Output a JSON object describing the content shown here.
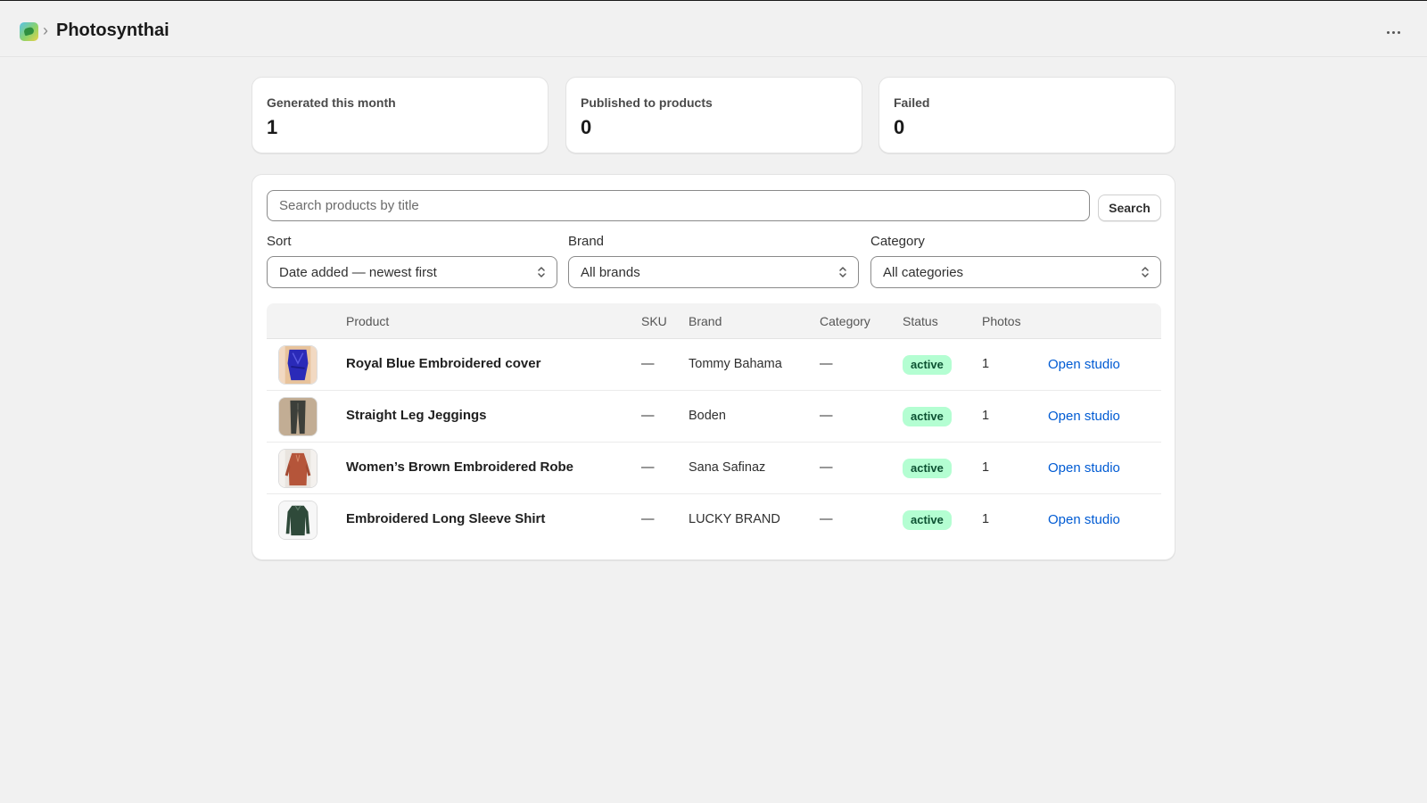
{
  "app": {
    "title": "Photosynthai",
    "breadcrumb_separator": "›",
    "icon": "app-leaf-icon",
    "more_icon": "more-horizontal-icon"
  },
  "stats": [
    {
      "label": "Generated this month",
      "value": "1"
    },
    {
      "label": "Published to products",
      "value": "0"
    },
    {
      "label": "Failed",
      "value": "0"
    }
  ],
  "search": {
    "placeholder": "Search products by title",
    "value": "",
    "button_label": "Search"
  },
  "filters": {
    "sort": {
      "label": "Sort",
      "value": "Date added — newest first"
    },
    "brand": {
      "label": "Brand",
      "value": "All brands"
    },
    "category": {
      "label": "Category",
      "value": "All categories"
    }
  },
  "table": {
    "columns": {
      "product": "Product",
      "sku": "SKU",
      "brand": "Brand",
      "category": "Category",
      "status": "Status",
      "photos": "Photos"
    },
    "rows": [
      {
        "product": "Royal Blue Embroidered cover",
        "sku": "—",
        "brand": "Tommy Bahama",
        "category": "—",
        "status": "active",
        "photos": "1",
        "action": "Open studio",
        "thumb": "royal-blue-garment"
      },
      {
        "product": "Straight Leg Jeggings",
        "sku": "—",
        "brand": "Boden",
        "category": "—",
        "status": "active",
        "photos": "1",
        "action": "Open studio",
        "thumb": "dark-jeggings"
      },
      {
        "product": "Women’s Brown Embroidered Robe",
        "sku": "—",
        "brand": "Sana Safinaz",
        "category": "—",
        "status": "active",
        "photos": "1",
        "action": "Open studio",
        "thumb": "brown-robe"
      },
      {
        "product": "Embroidered Long Sleeve Shirt",
        "sku": "—",
        "brand": "LUCKY BRAND",
        "category": "—",
        "status": "active",
        "photos": "1",
        "action": "Open studio",
        "thumb": "green-shirt"
      }
    ]
  },
  "colors": {
    "accent_link": "#005bd3",
    "status_active_bg": "#b4fed2",
    "status_active_text": "#0c5132",
    "page_bg": "#f1f1f1"
  }
}
